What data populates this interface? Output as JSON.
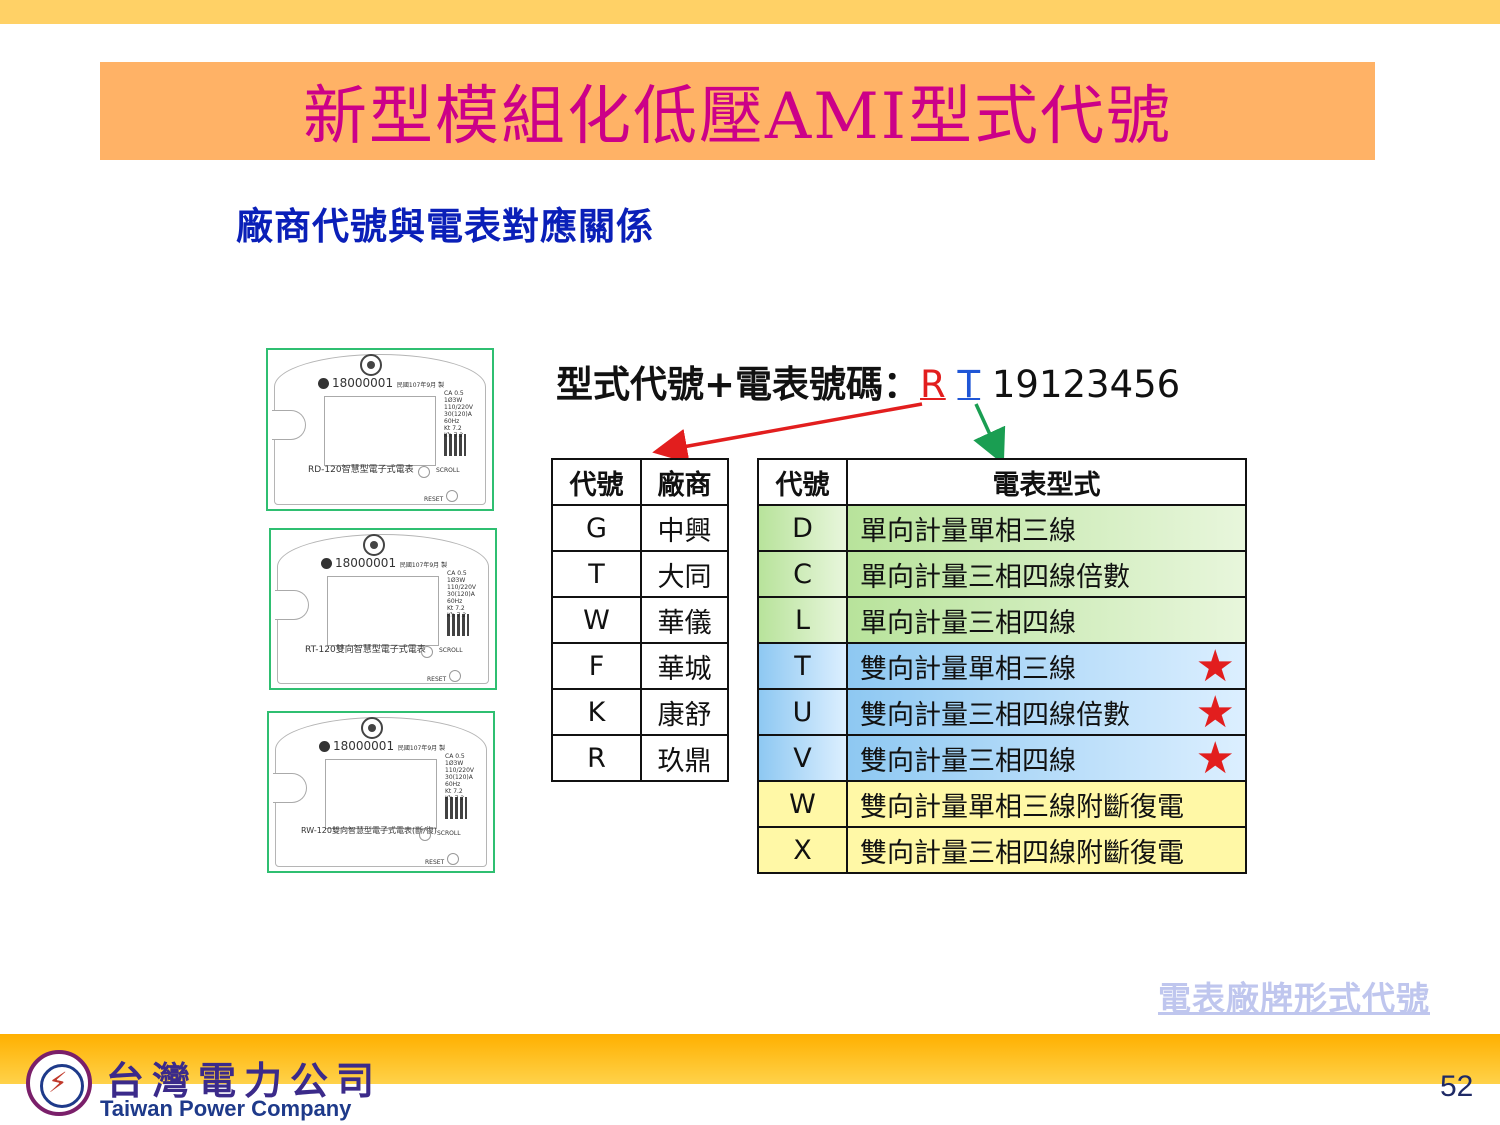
{
  "title": "新型模組化低壓AMI型式代號",
  "subtitle": "廠商代號與電表對應關係",
  "code_line": {
    "label": "型式代號+電表號碼：",
    "vendor_code": "R",
    "type_code": "T",
    "number": "19123456"
  },
  "meters": [
    {
      "serial": "18000001",
      "date": "民國107年9月 製",
      "model": "RD-120智慧型電子式電表",
      "specs": "CA 0.5\n1Ø3W\n110/220V\n30(120)A\n60Hz\nKt 7.2\nKh 7.2",
      "scroll": "SCROLL",
      "reset": "RESET"
    },
    {
      "serial": "18000001",
      "date": "民國107年9月 製",
      "model": "RT-120雙向智慧型電子式電表",
      "specs": "CA 0.5\n1Ø3W\n110/220V\n30(120)A\n60Hz\nKt 7.2\nKh 7.2",
      "scroll": "SCROLL",
      "reset": "RESET"
    },
    {
      "serial": "18000001",
      "date": "民國107年9月 製",
      "model": "RW-120雙向智慧型電子式電表(斷/復)",
      "specs": "CA 0.5\n1Ø3W\n110/220V\n30(120)A\n60Hz\nKt 7.2\nKh 7.2",
      "scroll": "SCROLL",
      "reset": "RESET"
    }
  ],
  "vendor_table": {
    "headers": [
      "代號",
      "廠商"
    ],
    "rows": [
      [
        "G",
        "中興"
      ],
      [
        "T",
        "大同"
      ],
      [
        "W",
        "華儀"
      ],
      [
        "F",
        "華城"
      ],
      [
        "K",
        "康舒"
      ],
      [
        "R",
        "玖鼎"
      ]
    ]
  },
  "type_table": {
    "headers": [
      "代號",
      "電表型式"
    ],
    "rows": [
      {
        "code": "D",
        "desc": "單向計量單相三線",
        "group": "green",
        "star": false
      },
      {
        "code": "C",
        "desc": "單向計量三相四線倍數",
        "group": "green",
        "star": false
      },
      {
        "code": "L",
        "desc": "單向計量三相四線",
        "group": "green",
        "star": false
      },
      {
        "code": "T",
        "desc": "雙向計量單相三線",
        "group": "blue",
        "star": true
      },
      {
        "code": "U",
        "desc": "雙向計量三相四線倍數",
        "group": "blue",
        "star": true
      },
      {
        "code": "V",
        "desc": "雙向計量三相四線",
        "group": "blue",
        "star": true
      },
      {
        "code": "W",
        "desc": "雙向計量單相三線附斷復電",
        "group": "yellow",
        "star": false
      },
      {
        "code": "X",
        "desc": "雙向計量三相四線附斷復電",
        "group": "yellow",
        "star": false
      }
    ],
    "star_glyph": "★"
  },
  "colors": {
    "title": "#cc0088",
    "title_bg": "#ffb266",
    "subtitle": "#0a1fb8",
    "vendor_code": "#e21e1e",
    "type_code": "#1f56d6",
    "star": "#e21e1e"
  },
  "footer_link": "電表廠牌形式代號",
  "company": {
    "name_zh": "台灣電力公司",
    "name_en": "Taiwan Power Company"
  },
  "page_number": "52"
}
